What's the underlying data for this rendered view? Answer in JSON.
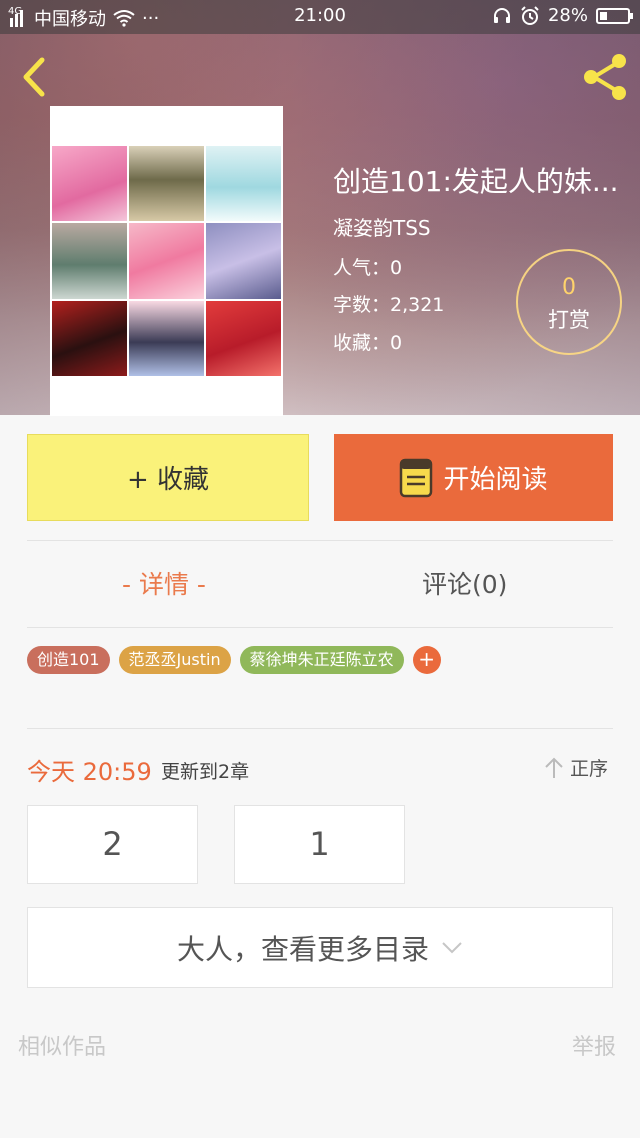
{
  "status_bar": {
    "network_type": "4G",
    "carrier": "中国移动",
    "dots": "···",
    "time": "21:00",
    "battery": "28%"
  },
  "header": {
    "back_icon": "chevron-left-icon",
    "share_icon": "share-icon",
    "accent_color": "#f7e34a"
  },
  "book": {
    "title": "创造101:发起人的妹...",
    "author": "凝姿韵TSS",
    "popularity": "人气：0",
    "word_count": "字数：2,321",
    "favorites": "收藏：0",
    "reward_count": "0",
    "reward_label": "打赏"
  },
  "actions": {
    "favorite_label": "+ 收藏",
    "read_label": "开始阅读",
    "read_color": "#ea6a3c",
    "favorite_color": "#faf27a"
  },
  "tabs": [
    {
      "label": "- 详情 -",
      "active": true
    },
    {
      "label": "评论(0)",
      "active": false
    }
  ],
  "tags": [
    {
      "label": "创造101",
      "color": "#c96f5d"
    },
    {
      "label": "范丞丞Justin",
      "color": "#dca346"
    },
    {
      "label": "蔡徐坤朱正廷陈立农",
      "color": "#90b85a"
    }
  ],
  "tag_add_label": "+",
  "updates": {
    "time": "今天 20:59",
    "text": "更新到2章",
    "sort_label": "正序"
  },
  "chapters": [
    "2",
    "1"
  ],
  "more_catalog_label": "大人，查看更多目录",
  "footer": {
    "similar_label": "相似作品",
    "report_label": "举报"
  }
}
